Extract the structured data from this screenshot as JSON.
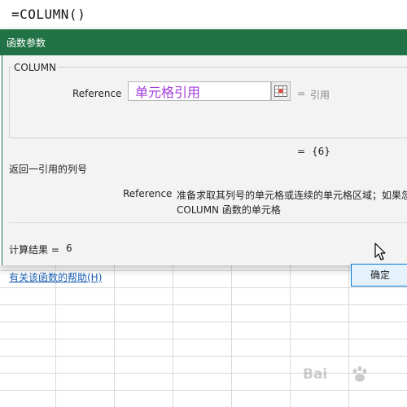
{
  "formula_bar": {
    "formula": "=COLUMN()"
  },
  "dialog": {
    "title": "函数参数",
    "function_name": "COLUMN",
    "argument": {
      "label": "Reference",
      "value": "单元格引用",
      "equals": "=",
      "hint": "引用"
    },
    "result_preview_equals": "=",
    "result_preview": "{6}",
    "function_description": "返回一引用的列号",
    "argument_description": {
      "name": "Reference",
      "line1": "准备求取其列号的单元格或连续的单元格区域；如果忽",
      "line2": "COLUMN 函数的单元格"
    },
    "calc_result_label": "计算结果 =",
    "calc_result_value": "6",
    "help_link": "有关该函数的帮助(H)",
    "ok_label": "确定"
  },
  "watermark": {
    "text": "Bai"
  },
  "colors": {
    "titlebar": "#217346",
    "argument_value": "#a13bd9",
    "link": "#1a5fb4",
    "ok_border": "#0078d7"
  },
  "icons": [
    "range-select-icon",
    "mouse-pointer-icon",
    "watermark-paw-icon"
  ]
}
